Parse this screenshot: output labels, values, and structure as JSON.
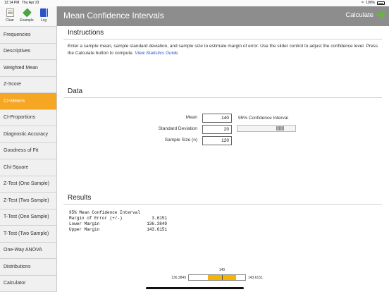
{
  "status_bar": {
    "time": "12:14 PM",
    "date": "Thu Apr 23",
    "battery": "100%"
  },
  "toolbar": {
    "clear": "Clear",
    "example": "Example",
    "log": "Log"
  },
  "sidebar": {
    "items": [
      {
        "label": "Frequencies",
        "active": false
      },
      {
        "label": "Descriptives",
        "active": false
      },
      {
        "label": "Weighted Mean",
        "active": false
      },
      {
        "label": "Z-Score",
        "active": false
      },
      {
        "label": "CI-Means",
        "active": true
      },
      {
        "label": "CI-Proportions",
        "active": false
      },
      {
        "label": "Diagnostic Accuracy",
        "active": false
      },
      {
        "label": "Goodness of Fit",
        "active": false
      },
      {
        "label": "Chi-Square",
        "active": false
      },
      {
        "label": "Z-Test (One Sample)",
        "active": false
      },
      {
        "label": "Z-Test (Two Sample)",
        "active": false
      },
      {
        "label": "T-Test (One Sample)",
        "active": false
      },
      {
        "label": "T-Test (Two Sample)",
        "active": false
      },
      {
        "label": "One-Way ANOVA",
        "active": false
      },
      {
        "label": "Distributions",
        "active": false
      },
      {
        "label": "Calculator",
        "active": false
      }
    ]
  },
  "header": {
    "title": "Mean Confidence Intervals",
    "calculate": "Calculate"
  },
  "instructions": {
    "title": "Instructions",
    "text": "Enter a sample mean, sample standard deviation, and sample size to estimate margin of error.  Use the slider control to adjust the confidence level.  Press the Calculate button to compute.",
    "link": "View Statistics Guide"
  },
  "data_section": {
    "title": "Data",
    "mean_label": "Mean",
    "mean_value": "140",
    "sd_label": "Standard Deviation",
    "sd_value": "20",
    "n_label": "Sample Size (n)",
    "n_value": "120",
    "interval_label": "95% Confidence Interval",
    "slider_fraction": 0.77
  },
  "results": {
    "title": "Results",
    "heading": "95% Mean Confidence Interval",
    "rows": [
      {
        "name": "Margin of Error (+/-)",
        "value": "3.6151"
      },
      {
        "name": "Lower Margin",
        "value": "136.3849"
      },
      {
        "name": "Upper Margin",
        "value": "143.6151"
      }
    ]
  },
  "interval_bar": {
    "center": "140",
    "lower": "136.3849",
    "upper": "143.6151",
    "axis_min": 131.5,
    "axis_max": 146.0,
    "fill_color": "#f5b400"
  },
  "colors": {
    "accent": "#f5a623",
    "header": "#8d8d8d",
    "link": "#2c52c6",
    "arrow": "#69b63c"
  }
}
